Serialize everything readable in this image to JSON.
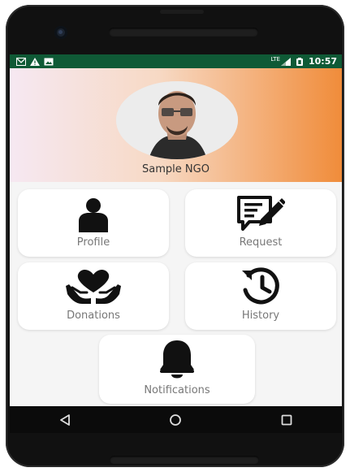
{
  "status_bar": {
    "time": "10:57",
    "network": "LTE",
    "icons": [
      "gmail-icon",
      "warning-icon",
      "image-icon",
      "signal-icon",
      "battery-icon"
    ]
  },
  "profile": {
    "org_name": "Sample NGO"
  },
  "menu": {
    "profile": "Profile",
    "request": "Request",
    "donations": "Donations",
    "history": "History",
    "notifications": "Notifications"
  },
  "nav": [
    "back-icon",
    "home-icon",
    "recents-icon"
  ],
  "colors": {
    "status_bar": "#0f5a36",
    "gradient_start": "#f6e8f2",
    "gradient_end": "#f08c3a",
    "tile_bg": "#ffffff",
    "label": "#777777"
  }
}
